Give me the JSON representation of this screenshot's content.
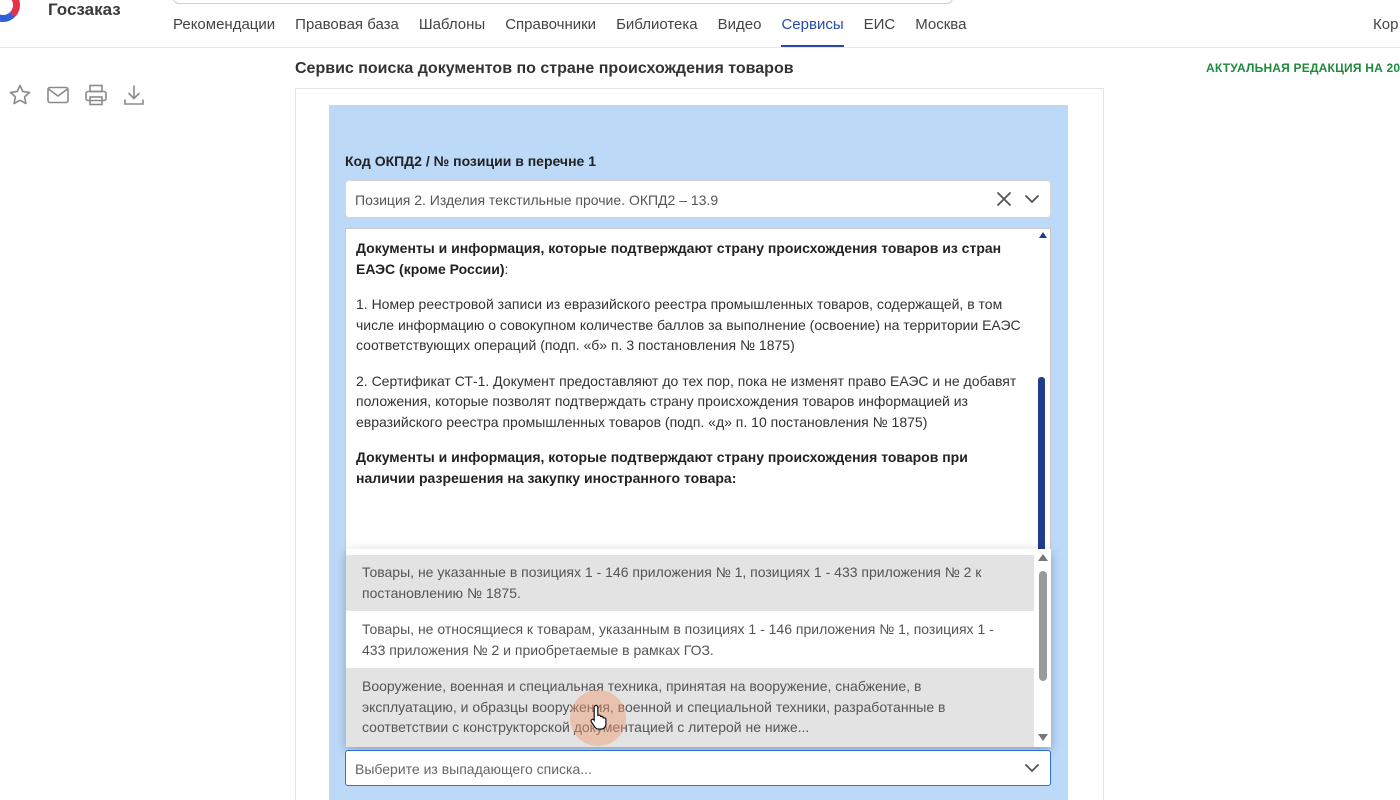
{
  "brand": {
    "logo_text": "Госзаказ"
  },
  "nav": {
    "items": [
      {
        "label": "Рекомендации"
      },
      {
        "label": "Правовая база"
      },
      {
        "label": "Шаблоны"
      },
      {
        "label": "Справочники"
      },
      {
        "label": "Библиотека"
      },
      {
        "label": "Видео"
      },
      {
        "label": "Сервисы",
        "active": true
      },
      {
        "label": "ЕИС"
      },
      {
        "label": "Москва"
      }
    ],
    "right_partial": "Кор"
  },
  "toolbar": {
    "icons": [
      "star-icon",
      "mail-icon",
      "print-icon",
      "download-icon"
    ]
  },
  "page": {
    "title": "Сервис поиска документов по стране происхождения товаров",
    "edition": "АКТУАЛЬНАЯ РЕДАКЦИЯ НА 20"
  },
  "form": {
    "field_label": "Код ОКПД2 / № позиции в перечне 1",
    "selected_value": "Позиция 2. Изделия текстильные прочие. ОКПД2 – 13.9",
    "info": {
      "heading1": "Документы и информация, которые подтверждают страну происхождения товаров из стран ЕАЭС (кроме России)",
      "heading1_suffix": ":",
      "item1": "1. Номер реестровой записи из евразийского реестра промышленных товаров, содержащей, в том числе информацию о совокупном количестве баллов за выполнение (освоение) на территории ЕАЭС соответствующих операций (подп. «б» п. 3 постановления № 1875)",
      "item2": "2. Сертификат СТ-1. Документ предоставляют до тех пор, пока не изменят право ЕАЭС и не добавят положения, которые позволят подтверждать страну происхождения товаров информацией из евразийского реестра промышленных товаров (подп. «д» п. 10 постановления № 1875)",
      "heading2": "Документы и информация, которые подтверждают страну происхождения товаров при наличии разрешения на закупку иностранного товара:"
    },
    "dropdown_options": [
      "Товары, не указанные в позициях 1 - 146 приложения № 1, позициях 1 - 433 приложения № 2 к постановлению № 1875.",
      "Товары, не относящиеся к товарам, указанным в позициях 1 - 146 приложения № 1, позициях 1 - 433 приложения № 2 и приобретаемые в рамках ГОЗ.",
      "Вооружение, военная и специальная техника, принятая на вооружение, снабжение, в эксплуатацию, и образцы вооружения, военной и специальной техники, разработанные в соответствии с конструкторской документацией с литерой не ниже..."
    ],
    "second_select_placeholder": "Выберите из выпадающего списка..."
  },
  "colors": {
    "panel_bg": "#bcd9f8",
    "nav_active": "#2a4aa8",
    "edition_green": "#1e8a3c",
    "scroll_thumb": "#1f3d8c"
  }
}
